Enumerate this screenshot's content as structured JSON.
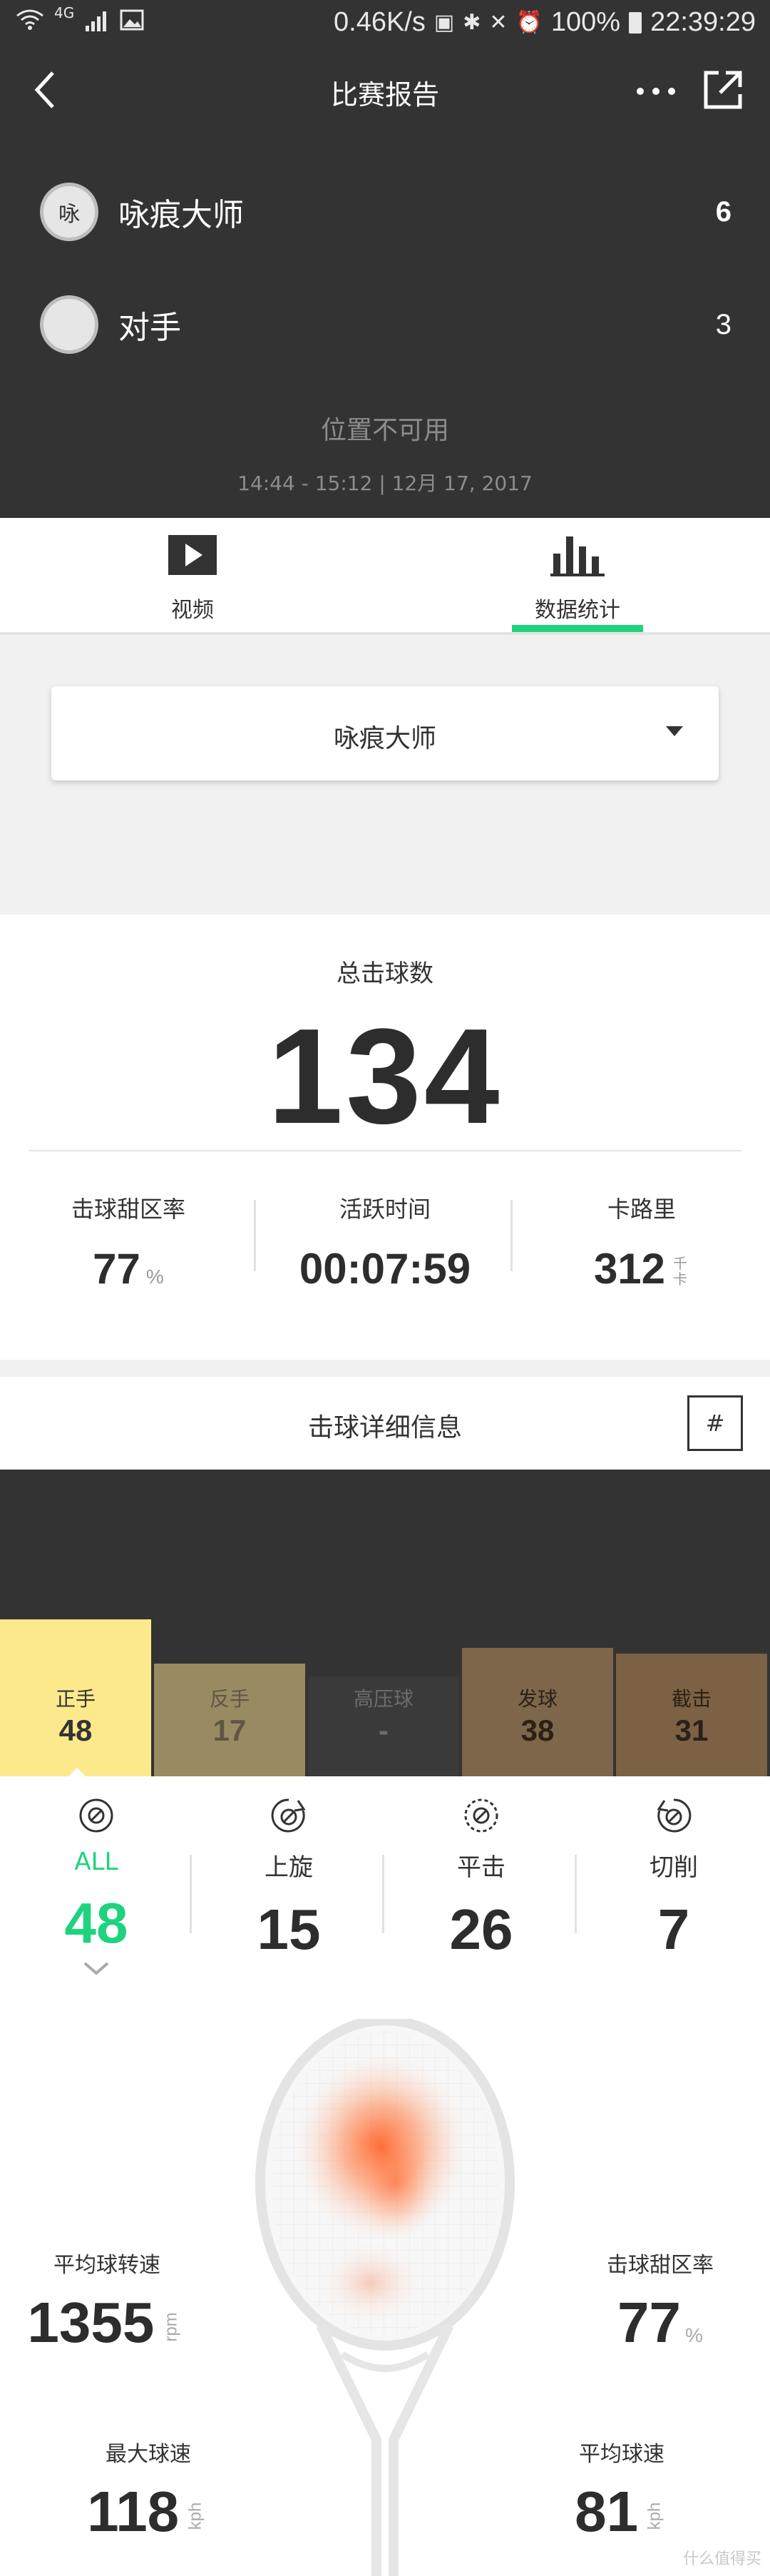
{
  "status_bar": {
    "network": "4G",
    "speed": "0.46K/s",
    "battery": "100%",
    "time": "22:39:29"
  },
  "header": {
    "title": "比赛报告",
    "players": [
      {
        "avatar": "咏",
        "name": "咏痕大师",
        "score": "6"
      },
      {
        "avatar": "",
        "name": "对手",
        "score": "3"
      }
    ],
    "location": "位置不可用",
    "datetime": "14:44 - 15:12 | 12月 17, 2017"
  },
  "tabs": [
    {
      "label": "视频",
      "icon": "play-icon"
    },
    {
      "label": "数据统计",
      "icon": "bar-chart-icon"
    }
  ],
  "selector": {
    "selected": "咏痕大师"
  },
  "summary": {
    "title": "总击球数",
    "total": "134",
    "stats": [
      {
        "label": "击球甜区率",
        "value": "77",
        "unit": "%"
      },
      {
        "label": "活跃时间",
        "value": "00:07:59",
        "unit": ""
      },
      {
        "label": "卡路里",
        "value": "312",
        "unit": "千卡"
      }
    ]
  },
  "details": {
    "title": "击球详细信息",
    "hash_label": "#"
  },
  "chart_data": {
    "type": "bar",
    "categories": [
      "正手",
      "反手",
      "高压球",
      "发球",
      "截击"
    ],
    "value_labels": [
      "48",
      "17",
      "-",
      "38",
      "31"
    ],
    "values": [
      48,
      17,
      0,
      38,
      31
    ],
    "selected_index": 0,
    "colors": [
      "#fce98c",
      "#9a8a62",
      "#3a3a3a",
      "#7d664a",
      "#7c6144"
    ],
    "text_colors": [
      "#333333",
      "#5e5545",
      "#6c6c6c",
      "#2b2116",
      "#2b2116"
    ]
  },
  "spin": [
    {
      "label": "ALL",
      "value": "48",
      "icon": "all-spin-icon",
      "active": true
    },
    {
      "label": "上旋",
      "value": "15",
      "icon": "topspin-icon",
      "active": false
    },
    {
      "label": "平击",
      "value": "26",
      "icon": "flat-icon",
      "active": false
    },
    {
      "label": "切削",
      "value": "7",
      "icon": "slice-icon",
      "active": false
    }
  ],
  "metrics": {
    "avg_spin": {
      "label": "平均球转速",
      "value": "1355",
      "unit": "rpm"
    },
    "sweet_spot": {
      "label": "击球甜区率",
      "value": "77",
      "unit": "%"
    },
    "max_speed": {
      "label": "最大球速",
      "value": "118",
      "unit": "kph"
    },
    "avg_speed": {
      "label": "平均球速",
      "value": "81",
      "unit": "kph"
    }
  },
  "watermark": "什么值得买",
  "accent_color": "#1ed37d"
}
